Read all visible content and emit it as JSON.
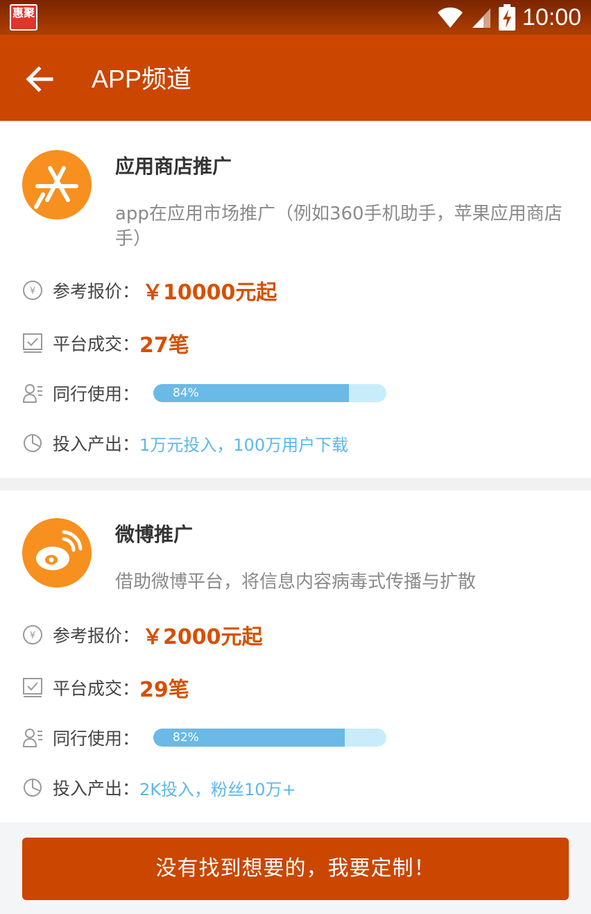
{
  "status_bar": {
    "app_icon_text": "惠聚",
    "time": "10:00",
    "icons": [
      "wifi-icon",
      "signal-icon",
      "battery-charging-icon"
    ]
  },
  "app_bar": {
    "title": "APP频道",
    "back_icon": "arrow-left-icon"
  },
  "colors": {
    "brand": "#cb4600",
    "price": "#d65000",
    "progress": "#6ab9e6",
    "progress_track": "#c9ecfa",
    "roi_text": "#5cb7ea",
    "logo": "#f7901e"
  },
  "cards": [
    {
      "logo_icon": "app-store-icon",
      "title": "应用商店推广",
      "description": "app在应用市场推广（例如360手机助手，苹果应用商店手）",
      "price_label": "参考报价：",
      "price_value": "￥10000元起",
      "deals_label": "平台成交：",
      "deals_value": "27笔",
      "usage_label": "同行使用：",
      "usage_percent": 84,
      "usage_text": "84%",
      "roi_label": "投入产出：",
      "roi_value": "1万元投入，100万用户下载"
    },
    {
      "logo_icon": "weibo-icon",
      "title": "微博推广",
      "description": "借助微博平台，将信息内容病毒式传播与扩散",
      "price_label": "参考报价：",
      "price_value": "￥2000元起",
      "deals_label": "平台成交：",
      "deals_value": "29笔",
      "usage_label": "同行使用：",
      "usage_percent": 82,
      "usage_text": "82%",
      "roi_label": "投入产出：",
      "roi_value": "2K投入，粉丝10万+"
    }
  ],
  "custom_button_label": "没有找到想要的，我要定制！"
}
